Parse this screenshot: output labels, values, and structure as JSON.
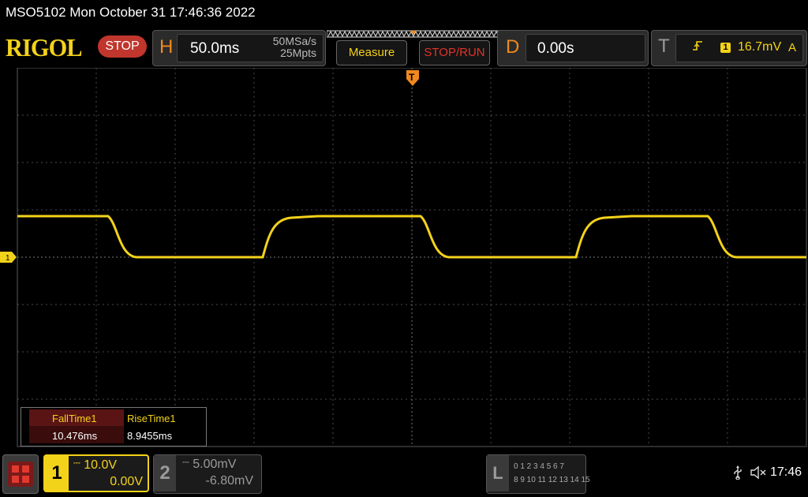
{
  "title": "MSO5102  Mon October 31 17:46:36 2022",
  "logo": "RIGOL",
  "status": "STOP",
  "horizontal": {
    "letter": "H",
    "timebase": "50.0ms",
    "sample_rate": "50MSa/s",
    "memory_depth": "25Mpts"
  },
  "buttons": {
    "measure": "Measure",
    "stop_run": "STOP/RUN"
  },
  "delay": {
    "letter": "D",
    "value": "0.00s"
  },
  "trigger": {
    "letter": "T",
    "edge_icon": "rising-edge-icon",
    "channel": "1",
    "level": "16.7mV",
    "mode": "A"
  },
  "measurements": [
    {
      "name": "FallTime1",
      "value": "10.476ms"
    },
    {
      "name": "RiseTime1",
      "value": "8.9455ms"
    }
  ],
  "channel1": {
    "num": "1",
    "scale": "10.0V",
    "offset": "0.00V",
    "marker": "1",
    "color": "#f3d21a"
  },
  "channel2": {
    "num": "2",
    "scale": "5.00mV",
    "offset": "-6.80mV"
  },
  "logic": {
    "letter": "L",
    "row1": "0 1 2 3  4 5 6 7",
    "row2": "8  9 10 11  12 13 14 15"
  },
  "clock": "17:46",
  "colors": {
    "accent": "#f3d21a",
    "stop": "#c0362c",
    "horizontal": "#f0891e"
  }
}
